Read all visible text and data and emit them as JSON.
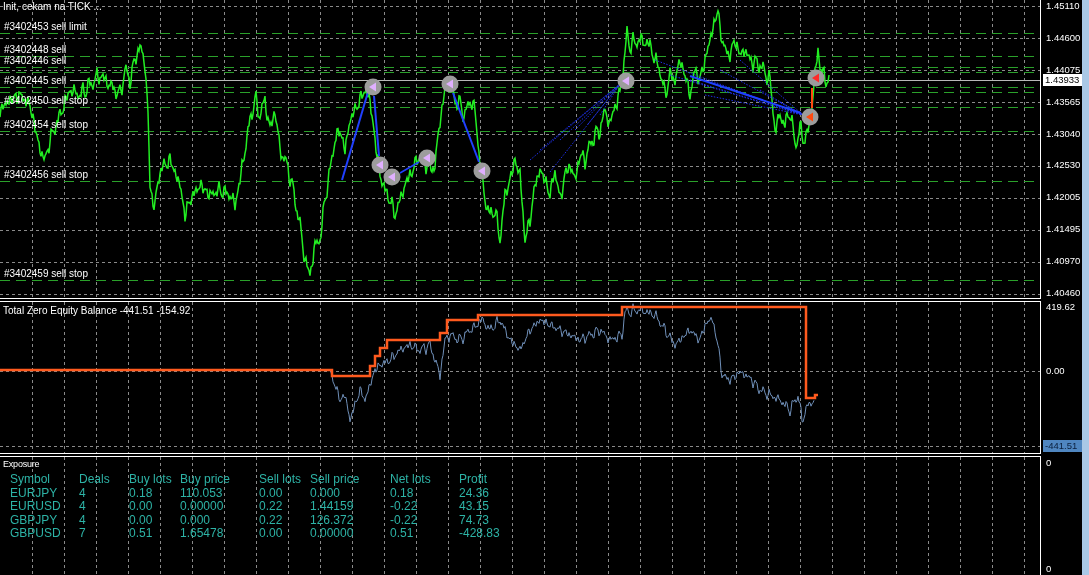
{
  "chart": {
    "status": "Init, cekam na TICK ...",
    "orders": [
      "#3402453 sell limit",
      "#3402448 sell",
      "#3402446 sell",
      "#3402445 sell",
      "#3402450 sell stop",
      "#3402454 sell stop",
      "#3402456 sell stop",
      "#3402459 sell stop"
    ],
    "price_axis": {
      "ticks": [
        "1.45110",
        "1.44600",
        "1.44075",
        "1.43565",
        "1.43040",
        "1.42530",
        "1.42005",
        "1.41495",
        "1.40970",
        "1.40460"
      ],
      "current_price": "1.43933"
    }
  },
  "equity_pane": {
    "title": "Total Zero Equity Balance -441.51 -154.92",
    "axis_ticks": [
      "419.62",
      "0.00"
    ],
    "current_value": "-441.51"
  },
  "exposure": {
    "title": "Exposure",
    "columns": [
      "Symbol",
      "Deals",
      "Buy lots",
      "Buy price",
      "Sell lots",
      "Sell price",
      "Net lots",
      "Profit"
    ],
    "rows": [
      [
        "EURJPY",
        "4",
        "0.18",
        "110.053",
        "0.00",
        "0.000",
        "0.18",
        "24.36"
      ],
      [
        "EURUSD",
        "4",
        "0.00",
        "0.00000",
        "0.22",
        "1.44159",
        "-0.22",
        "43.15"
      ],
      [
        "GBPJPY",
        "4",
        "0.00",
        "0.000",
        "0.22",
        "126.372",
        "-0.22",
        "74.73"
      ],
      [
        "GBPUSD",
        "7",
        "0.51",
        "1.65478",
        "0.00",
        "0.00000",
        "0.51",
        "-428.83"
      ]
    ],
    "axis_ticks": [
      "0",
      "0"
    ]
  }
}
